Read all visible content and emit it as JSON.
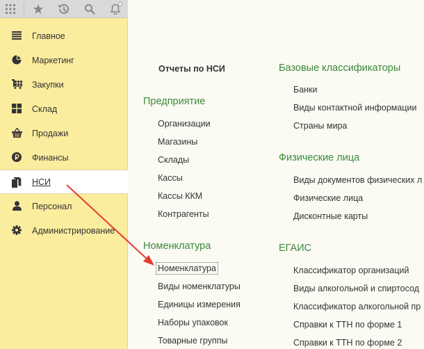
{
  "toolbar": {
    "icons": [
      "apps-grid-icon",
      "star-icon",
      "history-icon",
      "search-icon",
      "bell-icon"
    ]
  },
  "sidebar": {
    "items": [
      {
        "label": "Главное",
        "icon": "menu-lines-icon"
      },
      {
        "label": "Маркетинг",
        "icon": "pie-chart-icon"
      },
      {
        "label": "Закупки",
        "icon": "cart-icon"
      },
      {
        "label": "Склад",
        "icon": "warehouse-grid-icon"
      },
      {
        "label": "Продажи",
        "icon": "basket-icon"
      },
      {
        "label": "Финансы",
        "icon": "ruble-coin-icon"
      },
      {
        "label": "НСИ",
        "icon": "books-icon",
        "active": true
      },
      {
        "label": "Персонал",
        "icon": "person-icon"
      },
      {
        "label": "Администрирование",
        "icon": "gear-icon"
      }
    ]
  },
  "main": {
    "reports_title": "Отчеты по НСИ",
    "enterprise": {
      "title": "Предприятие",
      "links": [
        "Организации",
        "Магазины",
        "Склады",
        "Кассы",
        "Кассы ККМ",
        "Контрагенты"
      ]
    },
    "nomenclature": {
      "title": "Номенклатура",
      "links": [
        "Номенклатура",
        "Виды номенклатуры",
        "Единицы измерения",
        "Наборы упаковок",
        "Товарные группы"
      ]
    },
    "base_classifiers": {
      "title": "Базовые классификаторы",
      "links": [
        "Банки",
        "Виды контактной информации",
        "Страны мира"
      ]
    },
    "individuals": {
      "title": "Физические лица",
      "links": [
        "Виды документов физических л",
        "Физические лица",
        "Дисконтные карты"
      ]
    },
    "egais": {
      "title": "ЕГАИС",
      "links": [
        "Классификатор организаций",
        "Виды алкогольной и спиртосод",
        "Классификатор алкогольной пр",
        "Справки к ТТН по форме 1",
        "Справки к ТТН по форме 2"
      ]
    }
  },
  "colors": {
    "sidebar_bg": "#fbed9e",
    "section_green": "#3a8a3a",
    "arrow_red": "#e53b2f",
    "main_bg": "#fbfaf3"
  }
}
